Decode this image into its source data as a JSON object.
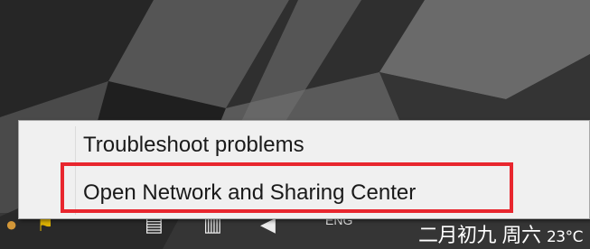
{
  "context_menu": {
    "items": [
      {
        "label": "Troubleshoot problems"
      },
      {
        "label": "Open Network and Sharing Center"
      }
    ]
  },
  "taskbar": {
    "language_indicator": "ENG",
    "clock_date": "二月初九 周六",
    "clock_temperature": "23°C",
    "tray_icons": [
      "app-tray-icon",
      "flag-icon",
      "display-icon",
      "network-icon",
      "volume-icon"
    ]
  },
  "colors": {
    "annotation_highlight": "#e8262e",
    "menu_background": "#f0f0f0"
  }
}
